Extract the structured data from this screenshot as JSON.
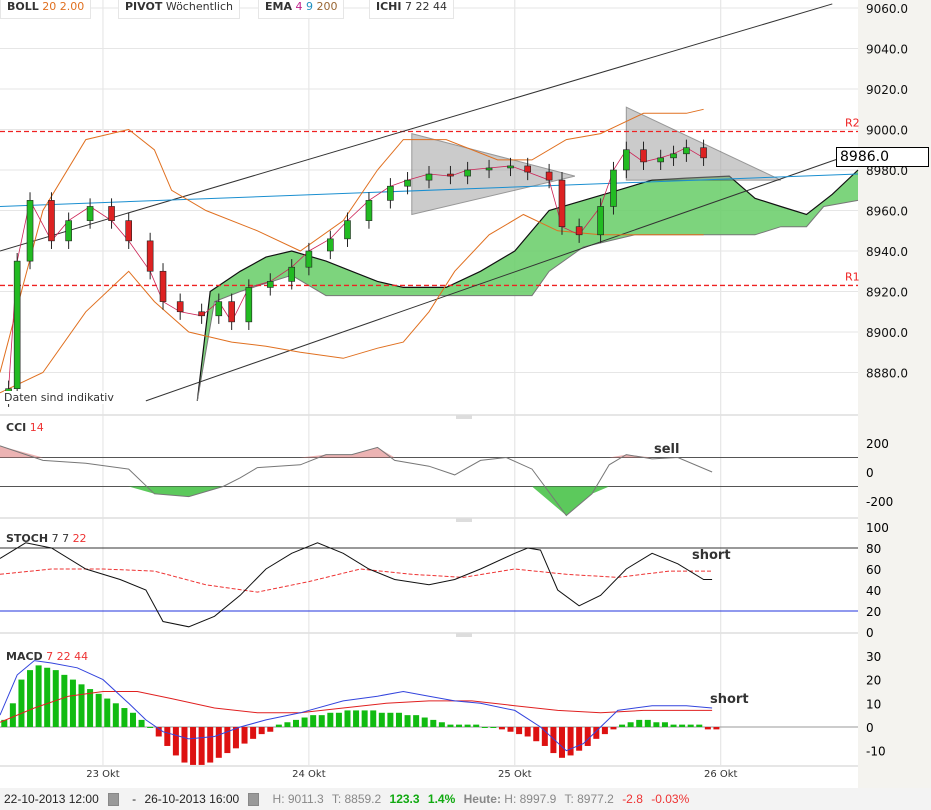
{
  "legend": {
    "boll": {
      "name": "BOLL",
      "p1": "20",
      "p2": "2.00"
    },
    "pivot": {
      "name": "PIVOT",
      "p1": "Wöchentlich"
    },
    "ema": {
      "name": "EMA",
      "p1": "4",
      "p2": "9",
      "p3": "200"
    },
    "ichi": {
      "name": "ICHI",
      "p1": "7",
      "p2": "22",
      "p3": "44"
    }
  },
  "note": "Daten sind indikativ",
  "last_price": "8986.0",
  "cci_label": {
    "name": "CCI",
    "p1": "14"
  },
  "stoch_label": {
    "name": "STOCH",
    "p1": "7",
    "p2": "7",
    "p3": "22"
  },
  "macd_label": {
    "name": "MACD",
    "p1": "7",
    "p2": "22",
    "p3": "44"
  },
  "annotations": {
    "cci": "sell",
    "stoch": "short",
    "macd": "short"
  },
  "status": {
    "from": "22-10-2013 12:00",
    "sep": "-",
    "to": "26-10-2013 16:00",
    "high": "H: 9011.3",
    "low": "T: 8859.2",
    "chg": "123.3",
    "pct": "1.4%",
    "today_label": "Heute:",
    "today_high": "H: 8997.9",
    "today_low": "T: 8977.2",
    "today_chg": "-2.8",
    "today_pct": "-0.03%"
  },
  "colors": {
    "up": "#22bb22",
    "down": "#dd2222",
    "boll": "#e07020",
    "cloud": "#66cc66",
    "pivot": "#ee2222"
  },
  "chart_data": [
    {
      "type": "candlestick",
      "title": "Price",
      "x_unit": "hours since 22-10-2013 12:00",
      "xlim": [
        0,
        100
      ],
      "ylim": [
        8866,
        9063
      ],
      "x_ticks": [
        {
          "x": 12,
          "label": "23 Okt"
        },
        {
          "x": 36,
          "label": "24 Okt"
        },
        {
          "x": 60,
          "label": "25 Okt"
        },
        {
          "x": 84,
          "label": "26 Okt"
        }
      ],
      "y_ticks": [
        8880,
        8900,
        8920,
        8940,
        8960,
        8980,
        9000,
        9020,
        9040,
        9060
      ],
      "pivots": [
        {
          "label": "R2",
          "value": 8999
        },
        {
          "label": "R1",
          "value": 8923
        }
      ],
      "closes": [
        [
          1,
          8872
        ],
        [
          2,
          8935
        ],
        [
          3.5,
          8965
        ],
        [
          6,
          8945
        ],
        [
          8,
          8955
        ],
        [
          10.5,
          8962
        ],
        [
          13,
          8955
        ],
        [
          15,
          8945
        ],
        [
          17.5,
          8930
        ],
        [
          19,
          8915
        ],
        [
          21,
          8910
        ],
        [
          23.5,
          8908
        ],
        [
          25.5,
          8915
        ],
        [
          27,
          8905
        ],
        [
          29,
          8922
        ],
        [
          31.5,
          8925
        ],
        [
          34,
          8932
        ],
        [
          36,
          8940
        ],
        [
          38.5,
          8946
        ],
        [
          40.5,
          8955
        ],
        [
          43,
          8965
        ],
        [
          45.5,
          8972
        ],
        [
          47.5,
          8975
        ],
        [
          50,
          8978
        ],
        [
          52.5,
          8977
        ],
        [
          54.5,
          8980
        ],
        [
          57,
          8981
        ],
        [
          59.5,
          8982
        ],
        [
          61.5,
          8979
        ],
        [
          64,
          8975
        ],
        [
          65.5,
          8952
        ],
        [
          67.5,
          8948
        ],
        [
          70,
          8962
        ],
        [
          71.5,
          8980
        ],
        [
          73,
          8990
        ],
        [
          75,
          8984
        ],
        [
          77,
          8986
        ],
        [
          78.5,
          8988
        ],
        [
          80,
          8991
        ],
        [
          82,
          8986
        ]
      ],
      "boll_upper": [
        [
          0,
          8880
        ],
        [
          5,
          8960
        ],
        [
          10,
          8995
        ],
        [
          15,
          9000
        ],
        [
          18,
          8990
        ],
        [
          20,
          8970
        ],
        [
          24,
          8960
        ],
        [
          30,
          8950
        ],
        [
          35,
          8940
        ],
        [
          40,
          8955
        ],
        [
          44,
          8980
        ],
        [
          47,
          8995
        ],
        [
          52,
          8995
        ],
        [
          58,
          8985
        ],
        [
          62,
          8985
        ],
        [
          66,
          8995
        ],
        [
          70,
          8998
        ],
        [
          75,
          9008
        ],
        [
          80,
          9008
        ],
        [
          82,
          9010
        ]
      ],
      "boll_lower": [
        [
          0,
          8870
        ],
        [
          5,
          8880
        ],
        [
          10,
          8910
        ],
        [
          15,
          8930
        ],
        [
          18,
          8915
        ],
        [
          22,
          8900
        ],
        [
          27,
          8895
        ],
        [
          31,
          8893
        ],
        [
          35,
          8890
        ],
        [
          40,
          8887
        ],
        [
          44,
          8892
        ],
        [
          47,
          8895
        ],
        [
          50,
          8910
        ],
        [
          53,
          8930
        ],
        [
          57,
          8948
        ],
        [
          61,
          8958
        ],
        [
          65,
          8950
        ],
        [
          70,
          8948
        ],
        [
          75,
          8948
        ],
        [
          80,
          8948
        ],
        [
          82,
          8948
        ]
      ],
      "cloud_top": [
        [
          23,
          8866
        ],
        [
          24.5,
          8920
        ],
        [
          28,
          8930
        ],
        [
          31,
          8937
        ],
        [
          34,
          8940
        ],
        [
          38,
          8935
        ],
        [
          41,
          8930
        ],
        [
          44,
          8925
        ],
        [
          47,
          8922
        ],
        [
          52,
          8922
        ],
        [
          56,
          8930
        ],
        [
          60,
          8940
        ],
        [
          64,
          8960
        ],
        [
          68,
          8965
        ],
        [
          72,
          8970
        ],
        [
          76,
          8975
        ],
        [
          80,
          8976
        ],
        [
          85,
          8977
        ],
        [
          88,
          8966
        ],
        [
          91,
          8962
        ],
        [
          94,
          8958
        ],
        [
          97,
          8968
        ],
        [
          100,
          8980
        ]
      ],
      "cloud_bottom": [
        [
          23,
          8866
        ],
        [
          25,
          8915
        ],
        [
          28,
          8920
        ],
        [
          34,
          8928
        ],
        [
          38,
          8918
        ],
        [
          42,
          8918
        ],
        [
          48,
          8918
        ],
        [
          52,
          8918
        ],
        [
          58,
          8918
        ],
        [
          62,
          8918
        ],
        [
          64,
          8930
        ],
        [
          68,
          8942
        ],
        [
          74,
          8948
        ],
        [
          80,
          8948
        ],
        [
          88,
          8948
        ],
        [
          91,
          8952
        ],
        [
          94,
          8952
        ],
        [
          96,
          8962
        ],
        [
          100,
          8965
        ]
      ],
      "trendlines": [
        [
          [
            0,
            8940
          ],
          [
            97,
            9062
          ]
        ],
        [
          [
            17,
            8866
          ],
          [
            98,
            8986
          ]
        ],
        [
          [
            0,
            8962
          ],
          [
            100,
            8978
          ]
        ]
      ],
      "triangles": [
        [
          [
            48,
            8998
          ],
          [
            67,
            8977
          ],
          [
            48,
            8958
          ]
        ],
        [
          [
            73,
            9011
          ],
          [
            91,
            8975
          ],
          [
            73,
            8975
          ]
        ]
      ]
    },
    {
      "type": "line",
      "title": "CCI 14",
      "ylim": [
        -250,
        250
      ],
      "y_ticks": [
        200,
        0,
        -200
      ],
      "levels": [
        100,
        -100
      ],
      "values": [
        [
          0,
          180
        ],
        [
          5,
          80
        ],
        [
          10,
          60
        ],
        [
          15,
          20
        ],
        [
          18,
          -150
        ],
        [
          22,
          -170
        ],
        [
          26,
          -100
        ],
        [
          28,
          -40
        ],
        [
          30,
          30
        ],
        [
          35,
          50
        ],
        [
          38,
          120
        ],
        [
          41,
          120
        ],
        [
          44,
          170
        ],
        [
          46,
          80
        ],
        [
          50,
          40
        ],
        [
          53,
          -20
        ],
        [
          56,
          80
        ],
        [
          59,
          100
        ],
        [
          62,
          20
        ],
        [
          66,
          -300
        ],
        [
          69,
          -150
        ],
        [
          71,
          50
        ],
        [
          73,
          120
        ],
        [
          76,
          90
        ],
        [
          79,
          100
        ],
        [
          83,
          0
        ]
      ]
    },
    {
      "type": "line",
      "title": "STOCH 7 7 22",
      "ylim": [
        0,
        100
      ],
      "y_ticks": [
        0,
        20,
        40,
        60,
        80,
        100
      ],
      "levels": [
        80,
        20
      ],
      "k": [
        [
          0,
          70
        ],
        [
          3,
          85
        ],
        [
          6,
          80
        ],
        [
          10,
          60
        ],
        [
          14,
          50
        ],
        [
          17,
          40
        ],
        [
          19,
          10
        ],
        [
          22,
          5
        ],
        [
          25,
          15
        ],
        [
          28,
          35
        ],
        [
          31,
          60
        ],
        [
          34,
          75
        ],
        [
          37,
          85
        ],
        [
          40,
          75
        ],
        [
          43,
          60
        ],
        [
          46,
          50
        ],
        [
          50,
          45
        ],
        [
          53,
          50
        ],
        [
          56,
          60
        ],
        [
          60,
          75
        ],
        [
          61.5,
          80
        ],
        [
          63,
          78
        ],
        [
          65,
          40
        ],
        [
          67.5,
          25
        ],
        [
          70,
          35
        ],
        [
          73,
          60
        ],
        [
          76,
          75
        ],
        [
          79,
          65
        ],
        [
          82,
          50
        ],
        [
          83,
          50
        ]
      ],
      "d": [
        [
          0,
          55
        ],
        [
          6,
          60
        ],
        [
          12,
          60
        ],
        [
          18,
          58
        ],
        [
          24,
          45
        ],
        [
          30,
          38
        ],
        [
          36,
          48
        ],
        [
          42,
          60
        ],
        [
          48,
          55
        ],
        [
          54,
          52
        ],
        [
          60,
          60
        ],
        [
          66,
          55
        ],
        [
          72,
          52
        ],
        [
          78,
          58
        ],
        [
          83,
          58
        ]
      ]
    },
    {
      "type": "bar+line",
      "title": "MACD 7 22 44",
      "ylim": [
        -17,
        33
      ],
      "y_ticks": [
        -10,
        0,
        10,
        20,
        30
      ],
      "histogram": [
        3,
        10,
        20,
        24,
        26,
        25,
        24,
        22,
        20,
        18,
        16,
        14,
        12,
        10,
        8,
        6,
        3,
        0,
        -4,
        -8,
        -12,
        -15,
        -16,
        -16,
        -15,
        -13,
        -11,
        -9,
        -7,
        -5,
        -3,
        -2,
        1,
        2,
        3,
        4,
        5,
        5,
        6,
        6,
        7,
        7,
        7,
        7,
        6,
        6,
        6,
        5,
        5,
        4,
        3,
        2,
        1,
        1,
        1,
        1,
        0,
        0,
        -1,
        -2,
        -3,
        -4,
        -6,
        -8,
        -11,
        -13,
        -12,
        -10,
        -8,
        -5,
        -3,
        -1,
        1,
        2,
        3,
        3,
        2,
        2,
        1,
        1,
        1,
        1,
        -1,
        -1
      ],
      "macd": [
        [
          0,
          5
        ],
        [
          2,
          22
        ],
        [
          4,
          28
        ],
        [
          6,
          27
        ],
        [
          9,
          25
        ],
        [
          12,
          20
        ],
        [
          15,
          10
        ],
        [
          17,
          3
        ],
        [
          19,
          -2
        ],
        [
          22,
          -5
        ],
        [
          25,
          -4
        ],
        [
          28,
          0
        ],
        [
          31,
          3
        ],
        [
          35,
          6
        ],
        [
          40,
          11
        ],
        [
          44,
          13
        ],
        [
          47,
          15
        ],
        [
          50,
          13
        ],
        [
          53,
          11
        ],
        [
          56,
          10
        ],
        [
          60,
          7
        ],
        [
          63,
          0
        ],
        [
          66,
          -10
        ],
        [
          68,
          -7
        ],
        [
          70,
          0
        ],
        [
          72,
          7
        ],
        [
          76,
          9
        ],
        [
          80,
          9
        ],
        [
          83,
          8
        ]
      ],
      "signal": [
        [
          0,
          2
        ],
        [
          4,
          8
        ],
        [
          8,
          13
        ],
        [
          12,
          15
        ],
        [
          16,
          15
        ],
        [
          20,
          12
        ],
        [
          25,
          8
        ],
        [
          30,
          6
        ],
        [
          35,
          6
        ],
        [
          40,
          8
        ],
        [
          45,
          10
        ],
        [
          50,
          11
        ],
        [
          55,
          11
        ],
        [
          60,
          9
        ],
        [
          65,
          7
        ],
        [
          70,
          6
        ],
        [
          75,
          7
        ],
        [
          80,
          7
        ],
        [
          83,
          7
        ]
      ]
    }
  ]
}
